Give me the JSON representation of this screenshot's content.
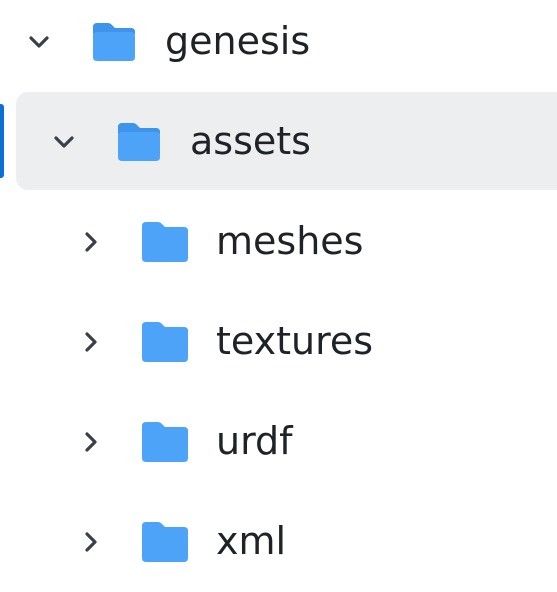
{
  "colors": {
    "folder": "#4da3f7",
    "folder_tab": "#3e93ea",
    "chevron": "#3b4046",
    "selected_bg": "#eceef0",
    "accent": "#0b6fd6",
    "text": "#1f2328"
  },
  "tree": {
    "root": {
      "label": "genesis",
      "expanded": true,
      "icon": "folder-open-icon"
    },
    "assets": {
      "label": "assets",
      "expanded": true,
      "selected": true,
      "icon": "folder-open-icon"
    },
    "children": [
      {
        "label": "meshes",
        "expanded": false,
        "icon": "folder-icon"
      },
      {
        "label": "textures",
        "expanded": false,
        "icon": "folder-icon"
      },
      {
        "label": "urdf",
        "expanded": false,
        "icon": "folder-icon"
      },
      {
        "label": "xml",
        "expanded": false,
        "icon": "folder-icon"
      }
    ]
  }
}
